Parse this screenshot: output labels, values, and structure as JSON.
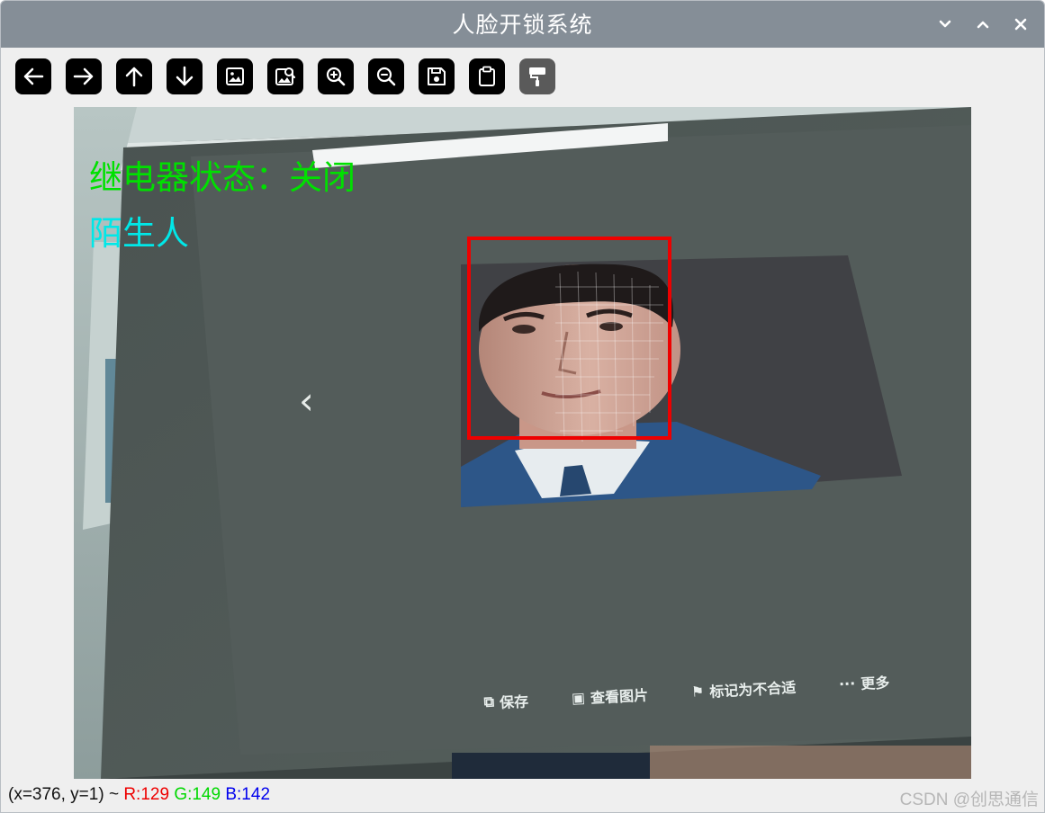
{
  "window": {
    "title": "人脸开锁系统",
    "controls": [
      "minimize-icon",
      "maximize-icon",
      "close-icon"
    ]
  },
  "toolbar": {
    "buttons": [
      {
        "name": "pan-left",
        "icon": "arrow-left-icon",
        "enabled": true
      },
      {
        "name": "pan-right",
        "icon": "arrow-right-icon",
        "enabled": true
      },
      {
        "name": "pan-up",
        "icon": "arrow-up-icon",
        "enabled": true
      },
      {
        "name": "pan-down",
        "icon": "arrow-down-icon",
        "enabled": true
      },
      {
        "name": "zoom-fit",
        "icon": "image-icon",
        "enabled": true
      },
      {
        "name": "zoom-inspect",
        "icon": "image-search-icon",
        "enabled": true
      },
      {
        "name": "zoom-in",
        "icon": "zoom-in-icon",
        "enabled": true
      },
      {
        "name": "zoom-out",
        "icon": "zoom-out-icon",
        "enabled": true
      },
      {
        "name": "save",
        "icon": "save-icon",
        "enabled": true
      },
      {
        "name": "copy",
        "icon": "clipboard-icon",
        "enabled": true
      },
      {
        "name": "properties",
        "icon": "paint-roller-icon",
        "enabled": false
      }
    ]
  },
  "video": {
    "relay_status": "继电器状态：关闭",
    "recognition_label": "陌生人",
    "face_box_color": "#ee0000",
    "relay_text_color": "#00e000",
    "recognition_text_color": "#00e8e8",
    "screen_back_glyph": "‹",
    "screen_actions": [
      {
        "icon": "save-icon",
        "label": "保存"
      },
      {
        "icon": "image-icon",
        "label": "查看图片"
      },
      {
        "icon": "flag-icon",
        "label": "标记为不合适"
      },
      {
        "icon": "more-icon",
        "label": "更多",
        "glyph": "···"
      }
    ]
  },
  "status": {
    "coords": "(x=376, y=1) ~",
    "r": "R:129",
    "g": "G:149",
    "b": "B:142"
  },
  "watermark": "CSDN @创思通信"
}
